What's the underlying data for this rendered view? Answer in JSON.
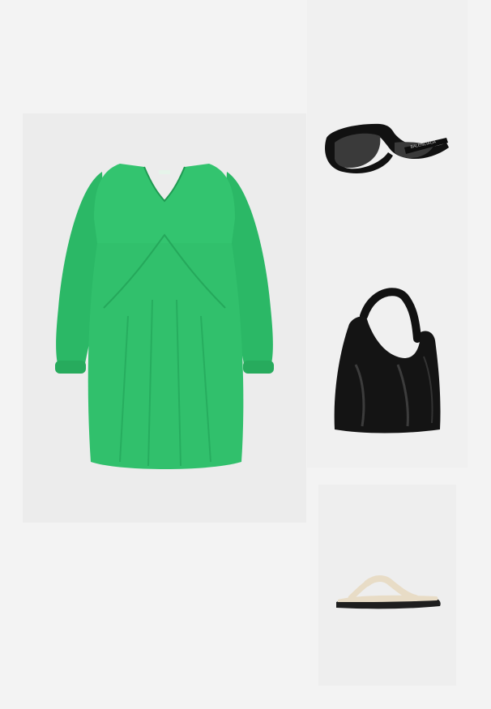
{
  "outfit": {
    "items": [
      {
        "kind": "dress",
        "color": "#2ec06a"
      },
      {
        "kind": "sunglasses",
        "color": "#111111",
        "temple_print": "BALENCIAGA"
      },
      {
        "kind": "bag",
        "color": "#141414"
      },
      {
        "kind": "sandal",
        "color": "#e8dcc6",
        "sole_color": "#1e1e1e"
      }
    ]
  }
}
